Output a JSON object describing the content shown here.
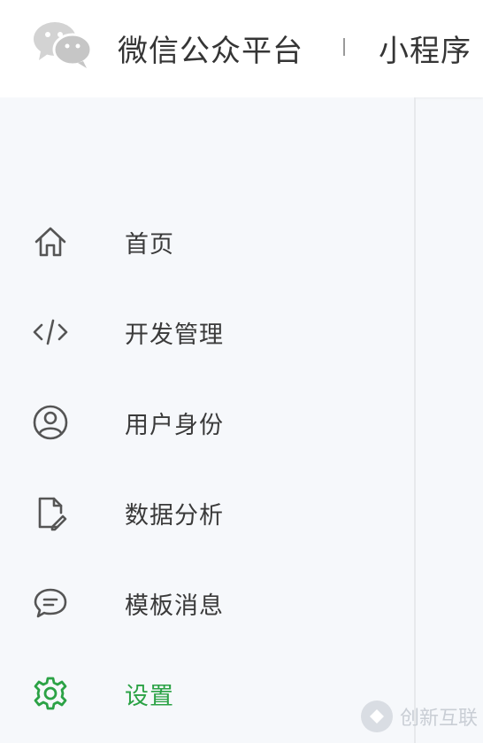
{
  "header": {
    "brand": "微信公众平台",
    "product": "小程序"
  },
  "nav": [
    {
      "label": "首页",
      "icon": "home-icon"
    },
    {
      "label": "开发管理",
      "icon": "code-icon"
    },
    {
      "label": "用户身份",
      "icon": "user-circle-icon"
    },
    {
      "label": "数据分析",
      "icon": "document-edit-icon"
    },
    {
      "label": "模板消息",
      "icon": "message-bubble-icon"
    },
    {
      "label": "设置",
      "icon": "gear-icon",
      "active": true
    }
  ],
  "watermark": {
    "text": "创新互联"
  },
  "colors": {
    "accent": "#2ba245",
    "icon": "#555555",
    "text": "#3a3a3a"
  }
}
